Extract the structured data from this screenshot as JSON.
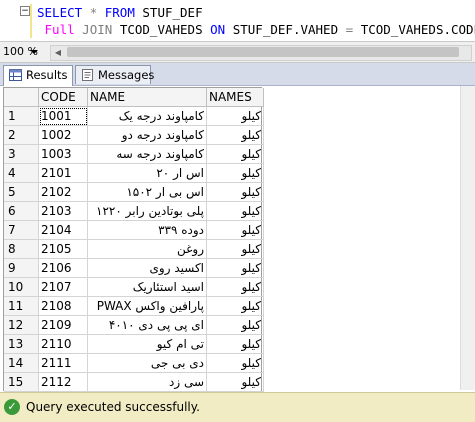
{
  "editor": {
    "line1": {
      "kw1": "SELECT",
      "star": "*",
      "kw2": "FROM",
      "table": "STUF_DEF"
    },
    "line2": {
      "kw1": "Full",
      "kw2": "JOIN",
      "table": "TCOD_VAHEDS",
      "kw3": "ON",
      "left": "STUF_DEF.VAHED",
      "eq": "=",
      "right": "TCOD_VAHEDS.CODE"
    }
  },
  "zoom": {
    "value": "100 %"
  },
  "tabs": [
    {
      "label": "Results",
      "icon": "grid-icon",
      "active": true
    },
    {
      "label": "Messages",
      "icon": "messages-icon",
      "active": false
    }
  ],
  "grid": {
    "columns": [
      "CODE",
      "NAME",
      "NAMES"
    ],
    "rows": [
      {
        "n": "1",
        "code": "1001",
        "name": "کامپاوند درجه یک",
        "names": "کیلو"
      },
      {
        "n": "2",
        "code": "1002",
        "name": "کامپاوند درجه دو",
        "names": "کیلو"
      },
      {
        "n": "3",
        "code": "1003",
        "name": "کامپاوند درجه سه",
        "names": "کیلو"
      },
      {
        "n": "4",
        "code": "2101",
        "name": "اس ار ۲۰",
        "names": "کیلو"
      },
      {
        "n": "5",
        "code": "2102",
        "name": "اس بی ار ۱۵۰۲",
        "names": "کیلو"
      },
      {
        "n": "6",
        "code": "2103",
        "name": "پلی بوتادین رابر ۱۲۲۰",
        "names": "کیلو"
      },
      {
        "n": "7",
        "code": "2104",
        "name": "دوده ۳۳۹",
        "names": "کیلو"
      },
      {
        "n": "8",
        "code": "2105",
        "name": "روغن",
        "names": "کیلو"
      },
      {
        "n": "9",
        "code": "2106",
        "name": "اکسید روی",
        "names": "کیلو"
      },
      {
        "n": "10",
        "code": "2107",
        "name": "اسید استئاریک",
        "names": "کیلو"
      },
      {
        "n": "11",
        "code": "2108",
        "name": "پارافین واکس PWAX",
        "names": "کیلو"
      },
      {
        "n": "12",
        "code": "2109",
        "name": "ای پی پی دی ۴۰۱۰",
        "names": "کیلو"
      },
      {
        "n": "13",
        "code": "2110",
        "name": "تی ام کیو",
        "names": "کیلو"
      },
      {
        "n": "14",
        "code": "2111",
        "name": "دی بی جی",
        "names": "کیلو"
      },
      {
        "n": "15",
        "code": "2112",
        "name": "سی زد",
        "names": "کیلو"
      }
    ]
  },
  "status": {
    "message": "Query executed successfully.",
    "icon": "check-icon",
    "color": "#f1ecc3"
  }
}
